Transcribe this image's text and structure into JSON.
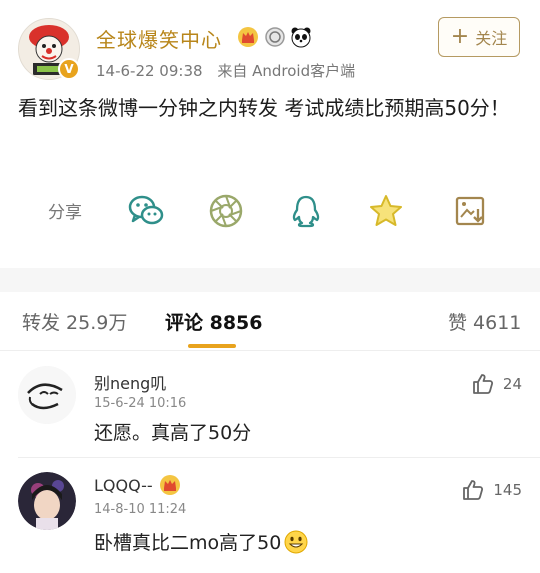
{
  "post": {
    "author": "全球爆笑中心",
    "verified_mark": "V",
    "time": "14-6-22 09:38",
    "source": "来自 Android客户端",
    "follow_label": "关注",
    "text": "看到这条微博一分钟之内转发 考试成绩比预期高50分！"
  },
  "share": {
    "label": "分享",
    "icons": [
      "wechat-icon",
      "moments-icon",
      "qq-icon",
      "qzone-star-icon",
      "save-image-icon"
    ]
  },
  "tabs": {
    "repost": "转发 25.9万",
    "comments": "评论 8856",
    "likes": "赞 4611"
  },
  "comments": [
    {
      "name": "别neng叽",
      "time": "15-6-24 10:16",
      "text": "还愿。真高了50分",
      "likes": "24"
    },
    {
      "name": "LQQQ--",
      "time": "14-8-10 11:24",
      "text": "卧槽真比二mo高了50",
      "likes": "145"
    }
  ],
  "colors": {
    "accent": "#e8a31d",
    "follow": "#a3864e",
    "share_icon": "#2f8f8a"
  }
}
